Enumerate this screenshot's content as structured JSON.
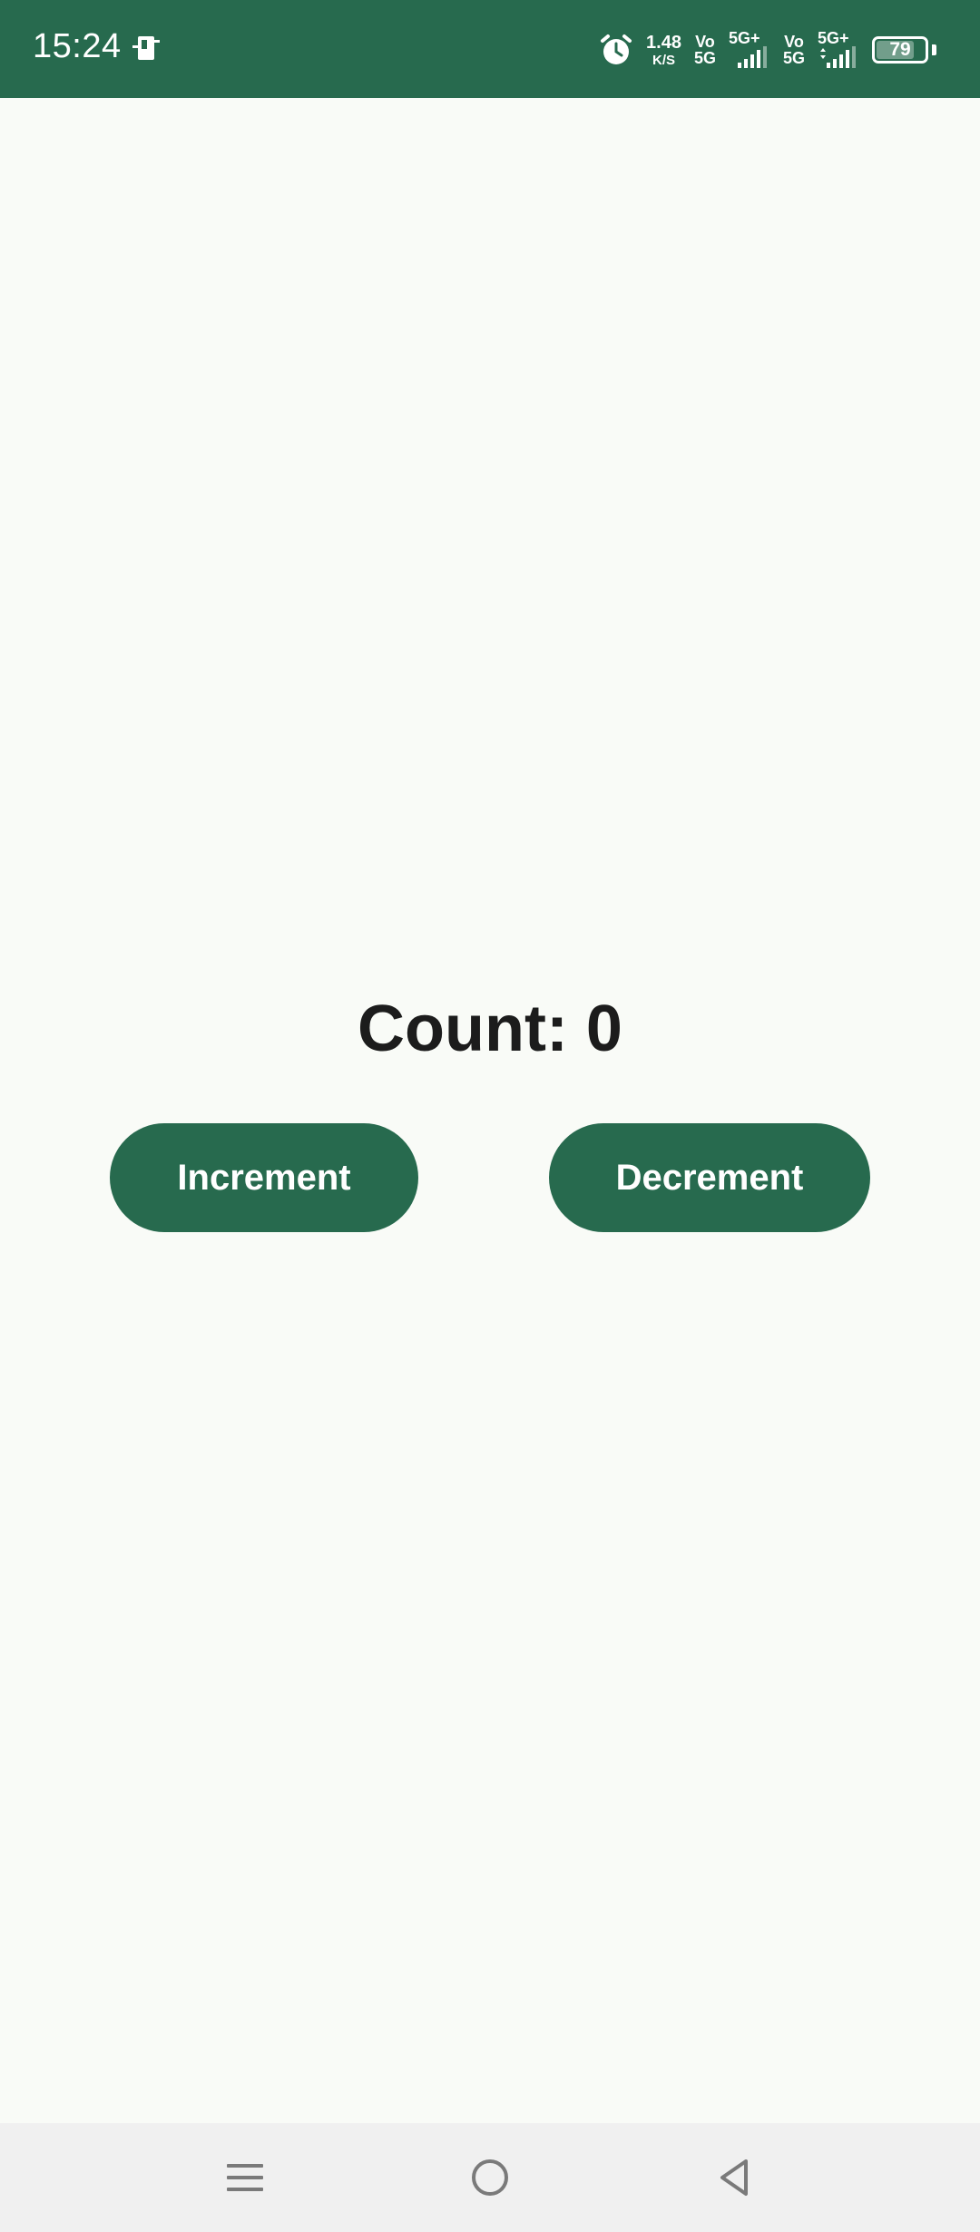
{
  "status_bar": {
    "time": "15:24",
    "net_speed_value": "1.48",
    "net_speed_unit": "K/S",
    "sim1_vo": "Vo",
    "sim1_5g": "5G",
    "sim1_type": "5G+",
    "sim2_vo": "Vo",
    "sim2_5g": "5G",
    "sim2_type": "5G+",
    "battery_level": "79",
    "battery_fraction": 0.79,
    "icons": [
      "sim-card-icon",
      "alarm-icon",
      "signal-icon",
      "battery-icon"
    ]
  },
  "main": {
    "count_text": "Count: 0",
    "increment_label": "Increment",
    "decrement_label": "Decrement"
  },
  "nav_bar": {
    "icons": [
      "menu-icon",
      "home-icon",
      "back-icon"
    ]
  },
  "colors": {
    "primary": "#276a4e",
    "background": "#f9fbf7",
    "text": "#1c1c1c",
    "nav_background": "#f0f0f0",
    "nav_icon": "#7a7a7a"
  }
}
